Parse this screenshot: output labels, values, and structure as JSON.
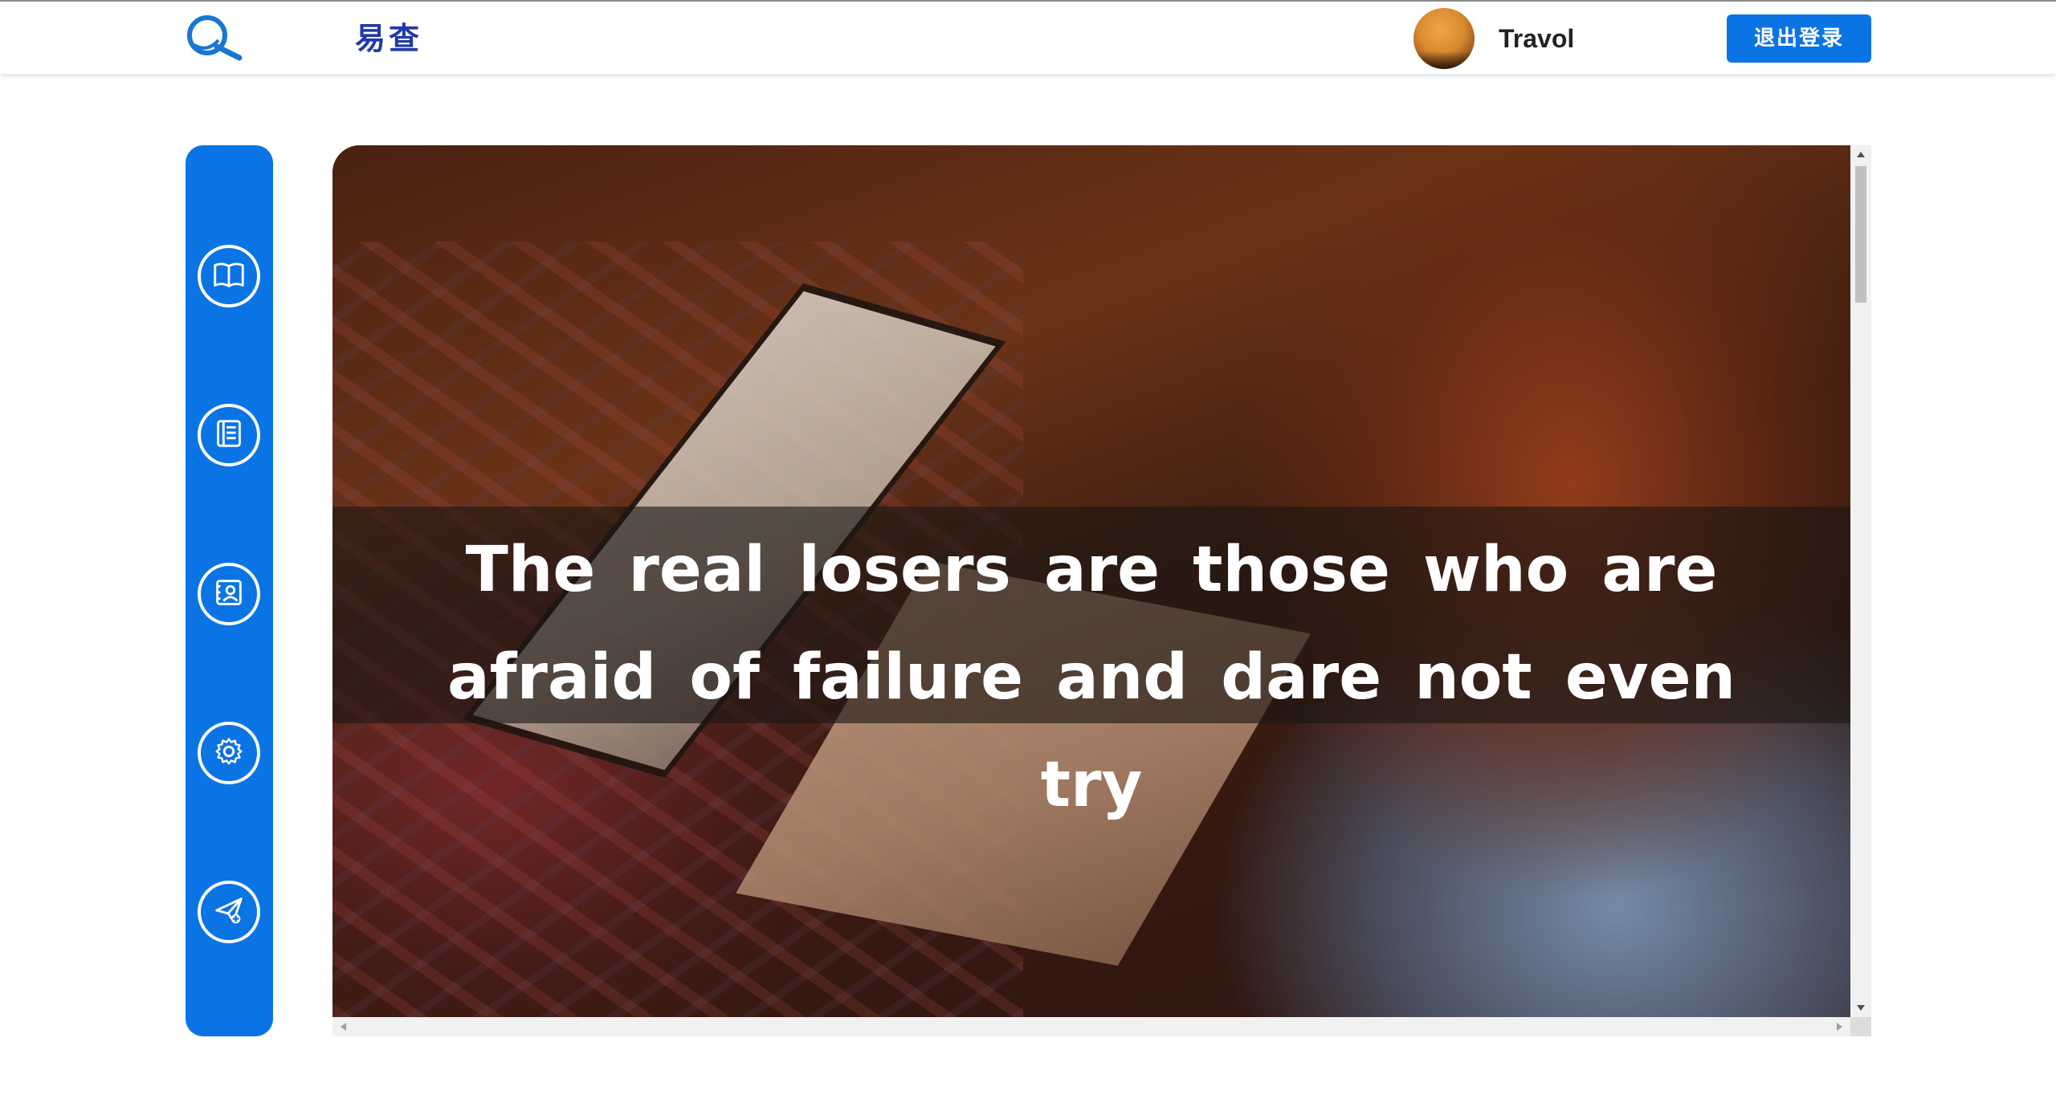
{
  "header": {
    "logo_icon": "search-magnifier-icon",
    "brand": "易查",
    "user": {
      "avatar_icon": "user-avatar",
      "name": "Travol"
    },
    "logout_label": "退出登录"
  },
  "sidebar": {
    "items": [
      {
        "icon": "book-icon"
      },
      {
        "icon": "list-document-icon"
      },
      {
        "icon": "contact-card-icon"
      },
      {
        "icon": "gear-icon"
      },
      {
        "icon": "send-plane-icon"
      }
    ]
  },
  "main": {
    "quote": "The real losers are those who are afraid of failure and dare not even try"
  },
  "colors": {
    "accent": "#0b74e5",
    "brand_text": "#1f3aa8"
  }
}
